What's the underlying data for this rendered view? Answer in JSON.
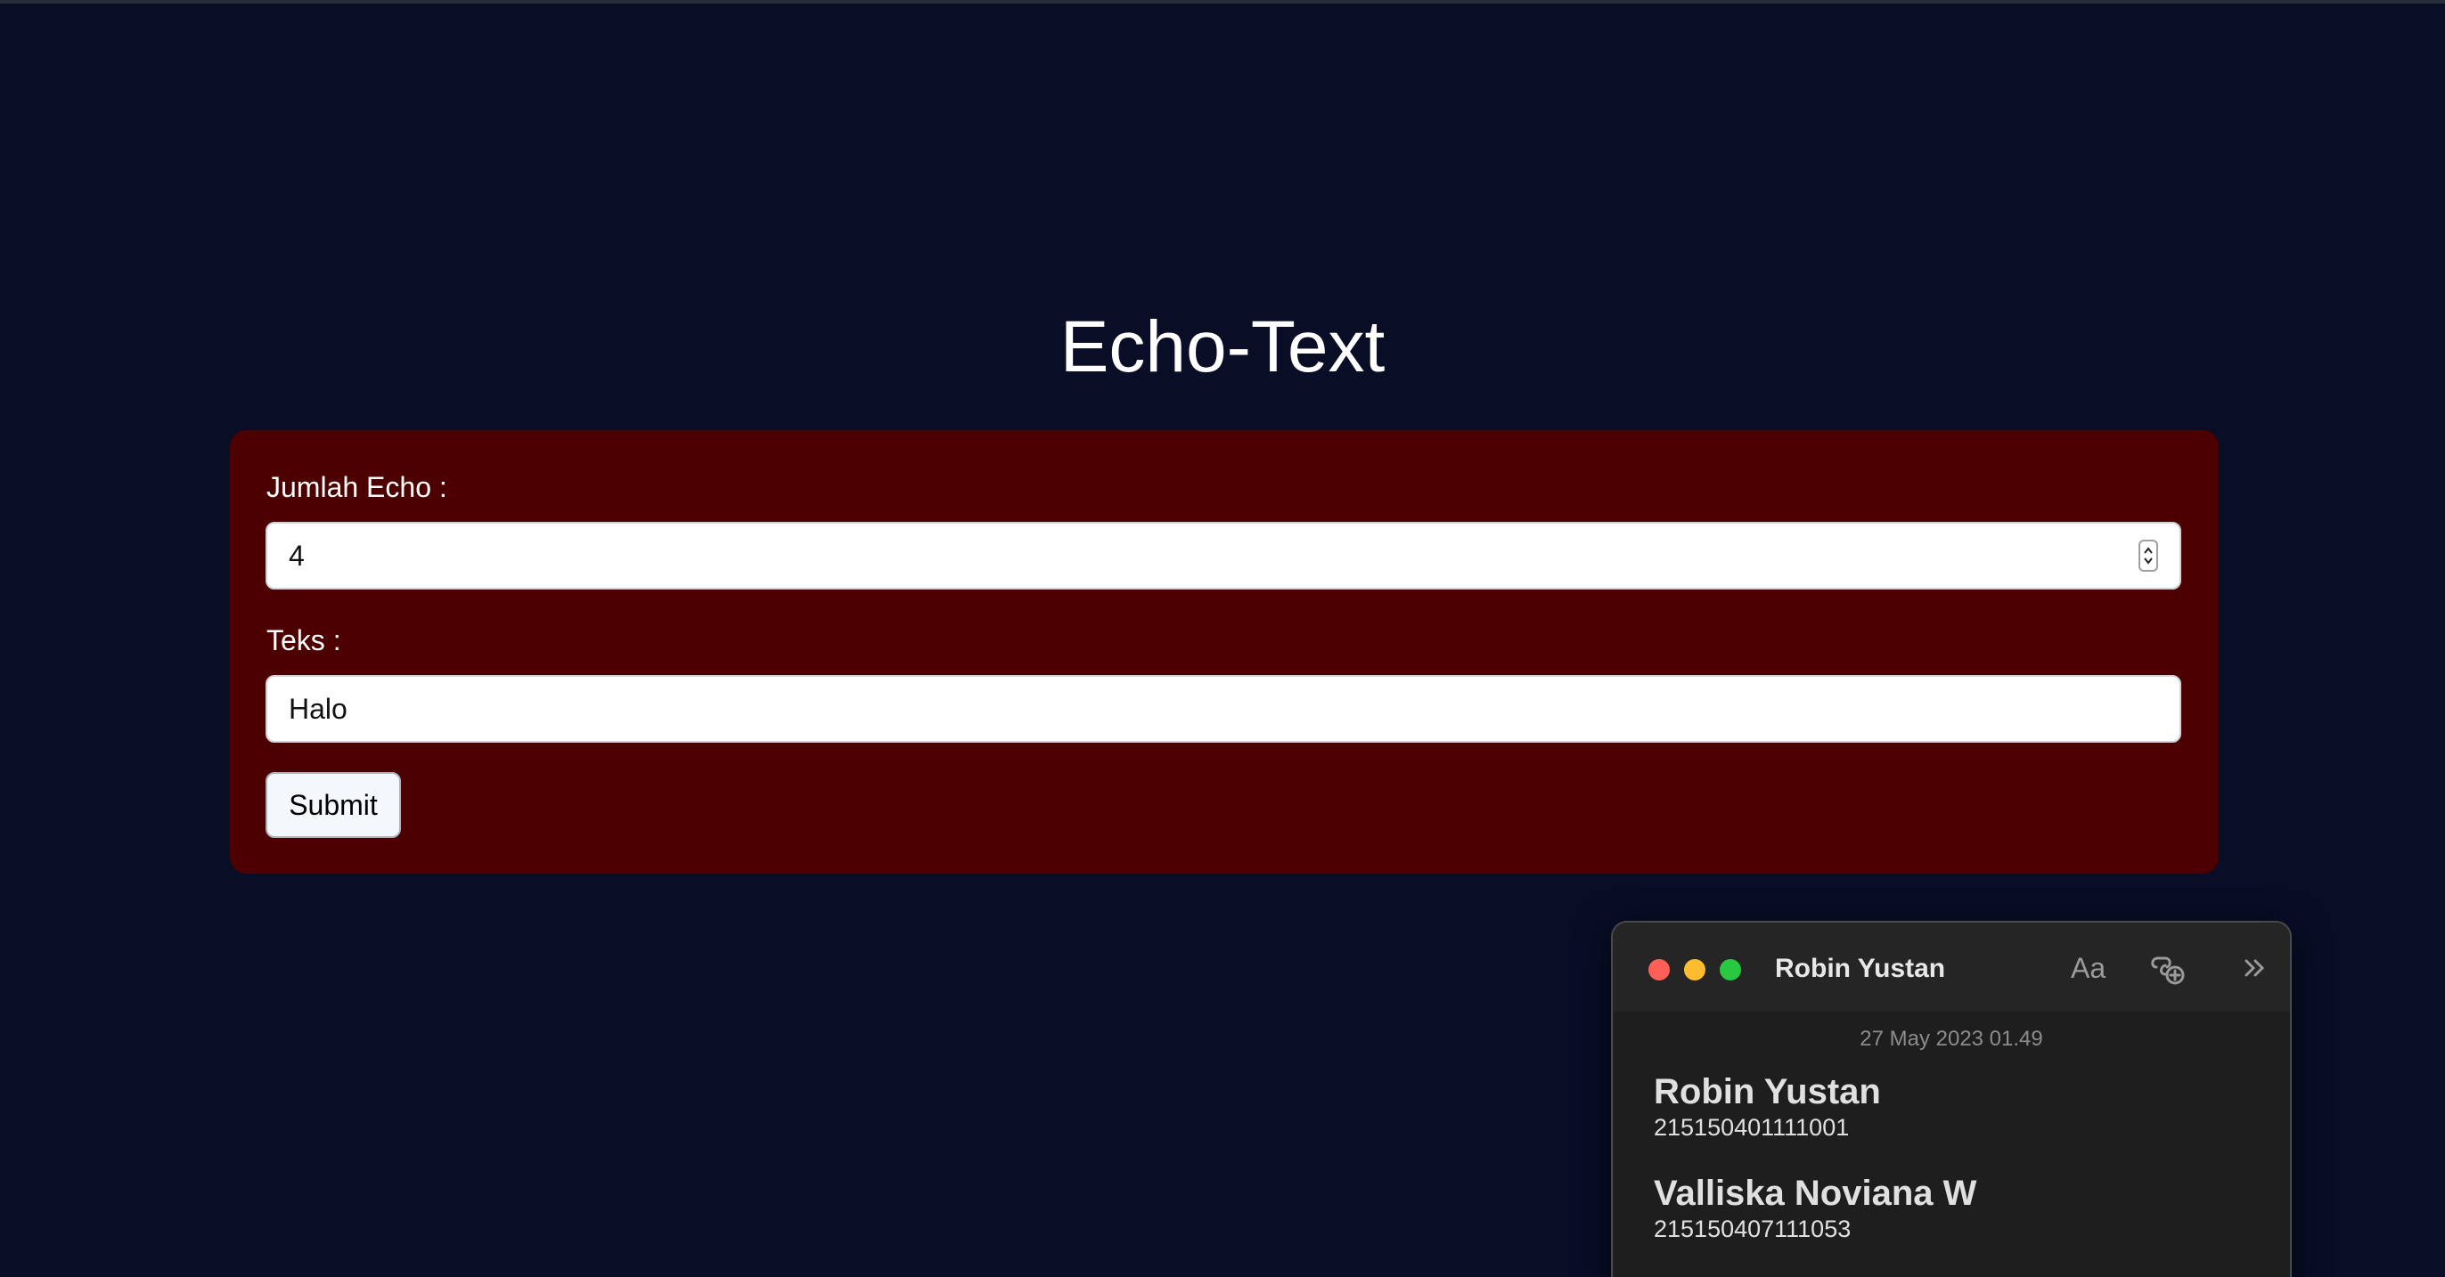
{
  "page": {
    "title": "Echo-Text"
  },
  "form": {
    "echo_label": "Jumlah Echo :",
    "echo_value": "4",
    "text_label": "Teks :",
    "text_value": "Halo",
    "submit_label": "Submit"
  },
  "notes": {
    "window_title": "Robin Yustan",
    "font_button": "Aa",
    "date": "27 May 2023 01.49",
    "entries": [
      {
        "name": "Robin Yustan",
        "id": "215150401111001"
      },
      {
        "name": "Valliska Noviana W",
        "id": "215150407111053"
      }
    ],
    "icons": [
      "close-icon",
      "minimize-icon",
      "zoom-icon",
      "collaborate-icon",
      "more-icon"
    ]
  },
  "colors": {
    "background": "#090d26",
    "card": "#4d0000",
    "notes_bg": "#1e1e1e"
  }
}
